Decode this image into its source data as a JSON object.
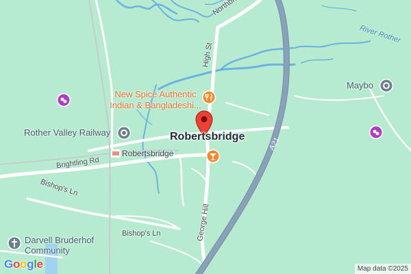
{
  "map": {
    "background": "#b7ebd0",
    "road_color": "#ffffff",
    "major_road_color": "#8aa2b9",
    "water_color": "#6ab2e3",
    "rail_color": "#c8cfd2"
  },
  "places": {
    "town": "Robertsbridge",
    "station": "Robertsbridge",
    "railway": "Rother Valley Railway",
    "maybo": "Maybo",
    "darvell_line1": "Darvell Bruderhof",
    "darvell_line2": "Community"
  },
  "restaurant": {
    "line1": "New Spice Authentic",
    "line2": "Indian & Bangladeshi..."
  },
  "streets": {
    "northbridge": "Northbridge St",
    "high_st": "High St",
    "brightling": "Brightling Rd",
    "bishops_1": "Bishop's Ln",
    "bishops_2": "Bishop's Ln",
    "george_hill": "George Hill",
    "a21": "A21"
  },
  "water": {
    "river": "River Rother"
  },
  "icons": {
    "location_pin": "red-location-pin-icon",
    "restaurant": "fork-knife-icon",
    "bar": "cocktail-icon",
    "attraction": "attraction-pin-icon",
    "tourist": "camera-lens-icon",
    "church": "cross-icon",
    "train": "train-station-icon"
  },
  "footer": {
    "logo": "Google",
    "credit": "Map data ©2025"
  },
  "logo_colors": [
    "#4285F4",
    "#EA4335",
    "#FBBC05",
    "#4285F4",
    "#34A853",
    "#EA4335"
  ]
}
